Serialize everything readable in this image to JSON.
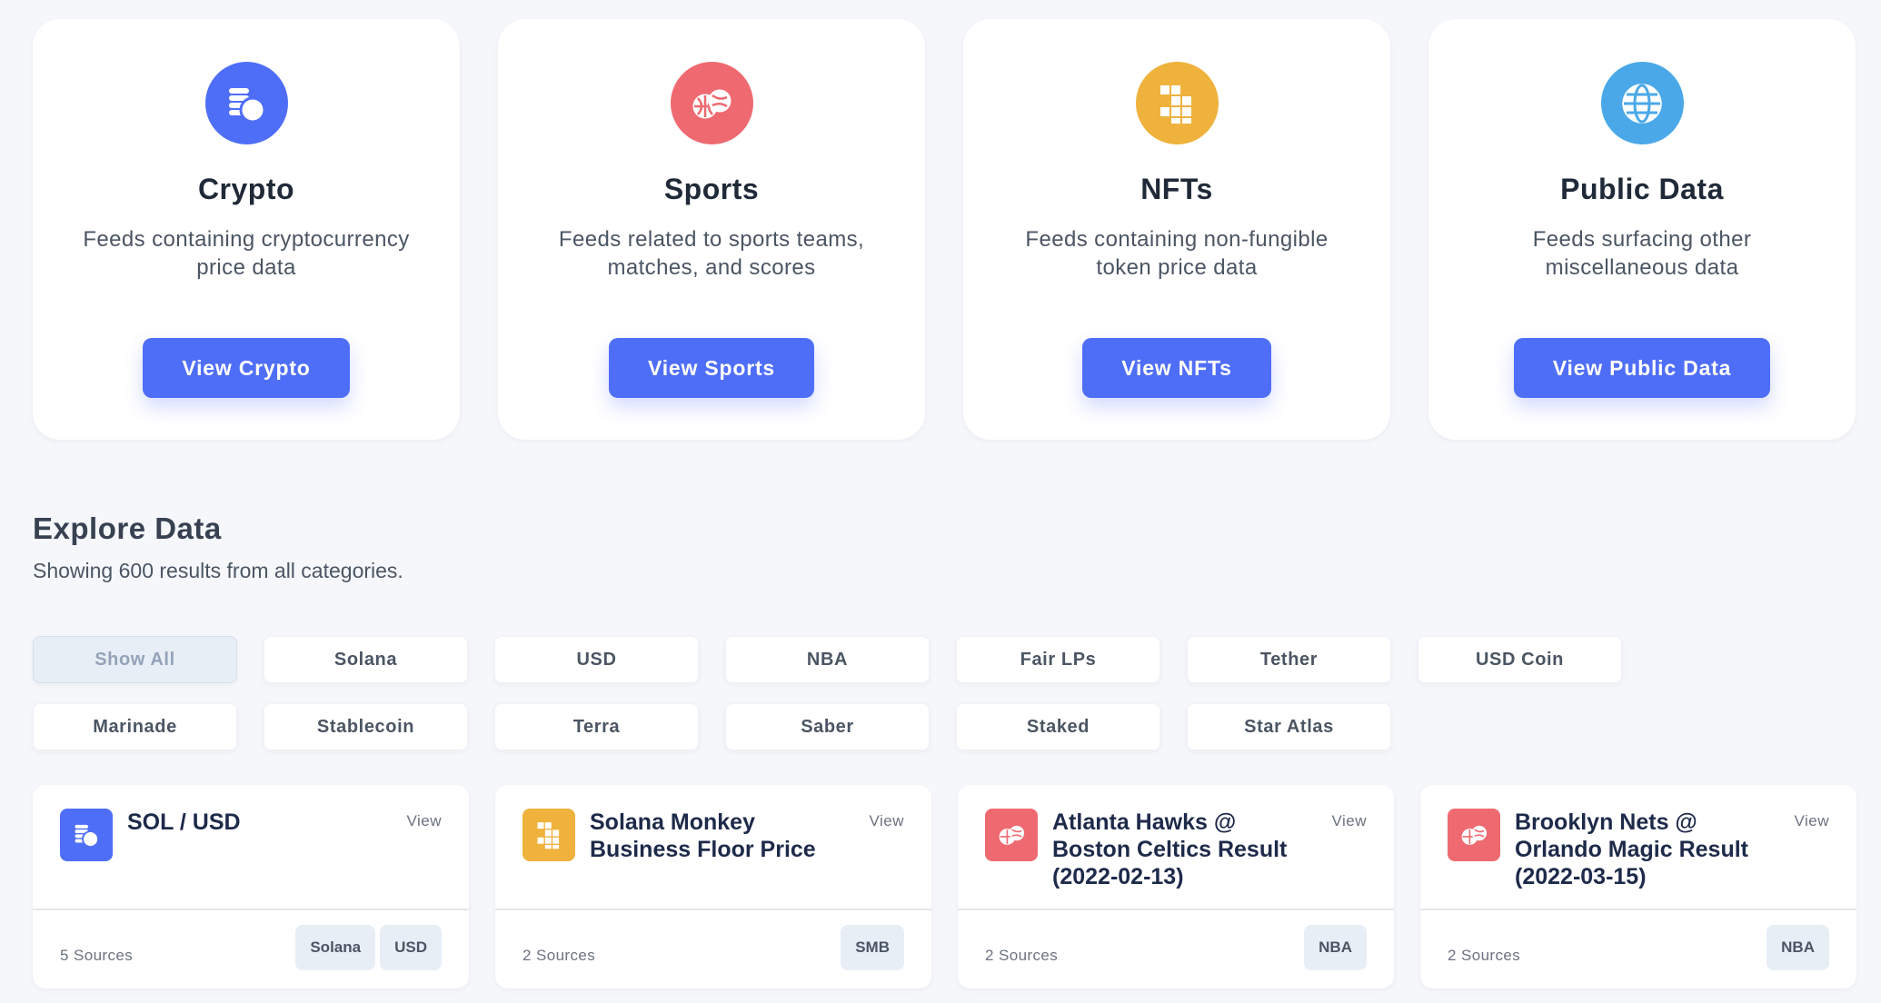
{
  "colors": {
    "primary": "#4f6ef7",
    "crypto": "#4f6ef7",
    "sports": "#ee6a70",
    "nfts": "#eeb23d",
    "public_data": "#4aa8e8",
    "background": "#f5f7fb"
  },
  "categories": [
    {
      "title": "Crypto",
      "desc": "Feeds containing cryptocurrency price data",
      "button": "View Crypto",
      "icon": "coins-icon"
    },
    {
      "title": "Sports",
      "desc": "Feeds related to sports teams, matches, and scores",
      "button": "View Sports",
      "icon": "sports-balls-icon"
    },
    {
      "title": "NFTs",
      "desc": "Feeds containing non-fungible token price data",
      "button": "View NFTs",
      "icon": "blocks-icon"
    },
    {
      "title": "Public Data",
      "desc": "Feeds surfacing other miscellaneous data",
      "button": "View Public Data",
      "icon": "globe-icon"
    }
  ],
  "explore": {
    "title": "Explore Data",
    "subtitle": "Showing 600 results from all categories."
  },
  "filters": [
    {
      "label": "Show All",
      "active": true
    },
    {
      "label": "Solana"
    },
    {
      "label": "USD"
    },
    {
      "label": "NBA"
    },
    {
      "label": "Fair LPs"
    },
    {
      "label": "Tether"
    },
    {
      "label": "USD Coin"
    },
    {
      "label": "Marinade"
    },
    {
      "label": "Stablecoin"
    },
    {
      "label": "Terra"
    },
    {
      "label": "Saber"
    },
    {
      "label": "Staked"
    },
    {
      "label": "Star Atlas"
    }
  ],
  "feeds": [
    {
      "title": "SOL / USD",
      "view": "View",
      "sources": "5 Sources",
      "tags": [
        "Solana",
        "USD"
      ],
      "icon": "coins-icon"
    },
    {
      "title": "Solana Monkey Business Floor Price",
      "view": "View",
      "sources": "2 Sources",
      "tags": [
        "SMB"
      ],
      "icon": "blocks-icon"
    },
    {
      "title": "Atlanta Hawks @ Boston Celtics Result (2022-02-13)",
      "view": "View",
      "sources": "2 Sources",
      "tags": [
        "NBA"
      ],
      "icon": "sports-balls-icon"
    },
    {
      "title": "Brooklyn Nets @ Orlando Magic Result (2022-03-15)",
      "view": "View",
      "sources": "2 Sources",
      "tags": [
        "NBA"
      ],
      "icon": "sports-balls-icon"
    }
  ]
}
